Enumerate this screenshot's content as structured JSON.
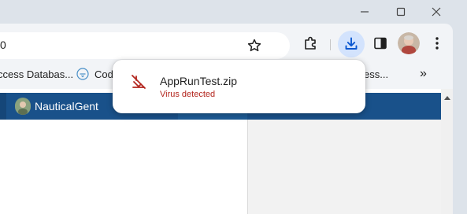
{
  "toolbar": {
    "address_text": "0"
  },
  "bookmarks": {
    "items": [
      {
        "label": "ccess Databas..."
      },
      {
        "label": "Cod"
      },
      {
        "label": "ess..."
      }
    ]
  },
  "page": {
    "site_name": "NauticalGent"
  },
  "download_bubble": {
    "filename": "AppRunTest.zip",
    "status": "Virus detected",
    "status_color": "#b3261e"
  },
  "colors": {
    "site_header": "#19518a",
    "download_active_bg": "#d3e3fd",
    "download_icon": "#0b57d0"
  },
  "icons": {
    "download": "download-icon",
    "warning": "file-warning-icon"
  }
}
